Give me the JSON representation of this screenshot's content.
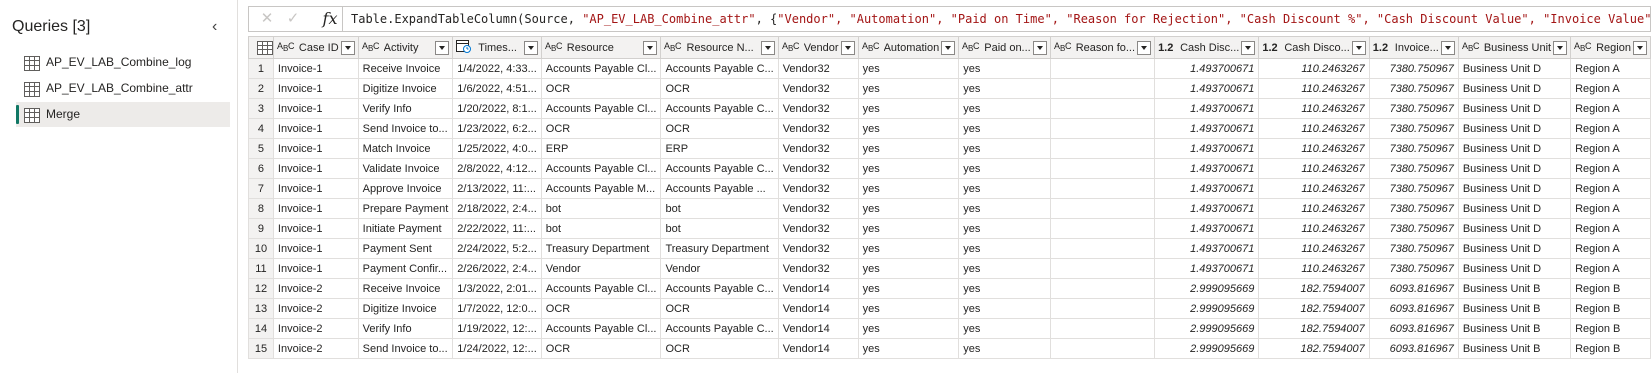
{
  "queries": {
    "header": "Queries [3]",
    "items": [
      {
        "label": "AP_EV_LAB_Combine_log",
        "selected": false
      },
      {
        "label": "AP_EV_LAB_Combine_attr",
        "selected": false
      },
      {
        "label": "Merge",
        "selected": true
      }
    ]
  },
  "formula": {
    "prefix": "Table.ExpandTableColumn(Source, ",
    "arg1": "\"AP_EV_LAB_Combine_attr\"",
    "mid": ", {",
    "cols": "\"Vendor\", \"Automation\", \"Paid on Time\", \"Reason for Rejection\", \"Cash Discount %\", \"Cash Discount Value\", \"Invoice Value\", \"Business Unit\""
  },
  "columns": [
    {
      "label": "Case ID",
      "type": "ABC"
    },
    {
      "label": "Activity",
      "type": "ABC"
    },
    {
      "label": "Times...",
      "type": "datetime"
    },
    {
      "label": "Resource",
      "type": "ABC"
    },
    {
      "label": "Resource N...",
      "type": "ABC"
    },
    {
      "label": "Vendor",
      "type": "ABC"
    },
    {
      "label": "Automation",
      "type": "ABC"
    },
    {
      "label": "Paid on...",
      "type": "ABC"
    },
    {
      "label": "Reason fo...",
      "type": "ABC"
    },
    {
      "label": "Cash Disc...",
      "type": "1.2"
    },
    {
      "label": "Cash Disco...",
      "type": "1.2"
    },
    {
      "label": "Invoice...",
      "type": "1.2"
    },
    {
      "label": "Business Unit",
      "type": "ABC"
    },
    {
      "label": "Region",
      "type": "ABC"
    }
  ],
  "rows": [
    [
      "1",
      "Invoice-1",
      "Receive Invoice",
      "1/4/2022, 4:33...",
      "Accounts Payable Cl...",
      "Accounts Payable C...",
      "Vendor32",
      "yes",
      "yes",
      "",
      "1.493700671",
      "110.2463267",
      "7380.750967",
      "Business Unit D",
      "Region A"
    ],
    [
      "2",
      "Invoice-1",
      "Digitize Invoice",
      "1/6/2022, 4:51...",
      "OCR",
      "OCR",
      "Vendor32",
      "yes",
      "yes",
      "",
      "1.493700671",
      "110.2463267",
      "7380.750967",
      "Business Unit D",
      "Region A"
    ],
    [
      "3",
      "Invoice-1",
      "Verify Info",
      "1/20/2022, 8:1...",
      "Accounts Payable Cl...",
      "Accounts Payable C...",
      "Vendor32",
      "yes",
      "yes",
      "",
      "1.493700671",
      "110.2463267",
      "7380.750967",
      "Business Unit D",
      "Region A"
    ],
    [
      "4",
      "Invoice-1",
      "Send Invoice to...",
      "1/23/2022, 6:2...",
      "OCR",
      "OCR",
      "Vendor32",
      "yes",
      "yes",
      "",
      "1.493700671",
      "110.2463267",
      "7380.750967",
      "Business Unit D",
      "Region A"
    ],
    [
      "5",
      "Invoice-1",
      "Match Invoice",
      "1/25/2022, 4:0...",
      "ERP",
      "ERP",
      "Vendor32",
      "yes",
      "yes",
      "",
      "1.493700671",
      "110.2463267",
      "7380.750967",
      "Business Unit D",
      "Region A"
    ],
    [
      "6",
      "Invoice-1",
      "Validate Invoice",
      "2/8/2022, 4:12...",
      "Accounts Payable Cl...",
      "Accounts Payable C...",
      "Vendor32",
      "yes",
      "yes",
      "",
      "1.493700671",
      "110.2463267",
      "7380.750967",
      "Business Unit D",
      "Region A"
    ],
    [
      "7",
      "Invoice-1",
      "Approve Invoice",
      "2/13/2022, 11:...",
      "Accounts Payable M...",
      "Accounts Payable ...",
      "Vendor32",
      "yes",
      "yes",
      "",
      "1.493700671",
      "110.2463267",
      "7380.750967",
      "Business Unit D",
      "Region A"
    ],
    [
      "8",
      "Invoice-1",
      "Prepare Payment",
      "2/18/2022, 2:4...",
      "bot",
      "bot",
      "Vendor32",
      "yes",
      "yes",
      "",
      "1.493700671",
      "110.2463267",
      "7380.750967",
      "Business Unit D",
      "Region A"
    ],
    [
      "9",
      "Invoice-1",
      "Initiate Payment",
      "2/22/2022, 11:...",
      "bot",
      "bot",
      "Vendor32",
      "yes",
      "yes",
      "",
      "1.493700671",
      "110.2463267",
      "7380.750967",
      "Business Unit D",
      "Region A"
    ],
    [
      "10",
      "Invoice-1",
      "Payment Sent",
      "2/24/2022, 5:2...",
      "Treasury Department",
      "Treasury Department",
      "Vendor32",
      "yes",
      "yes",
      "",
      "1.493700671",
      "110.2463267",
      "7380.750967",
      "Business Unit D",
      "Region A"
    ],
    [
      "11",
      "Invoice-1",
      "Payment Confir...",
      "2/26/2022, 2:4...",
      "Vendor",
      "Vendor",
      "Vendor32",
      "yes",
      "yes",
      "",
      "1.493700671",
      "110.2463267",
      "7380.750967",
      "Business Unit D",
      "Region A"
    ],
    [
      "12",
      "Invoice-2",
      "Receive Invoice",
      "1/3/2022, 2:01...",
      "Accounts Payable Cl...",
      "Accounts Payable C...",
      "Vendor14",
      "yes",
      "yes",
      "",
      "2.999095669",
      "182.7594007",
      "6093.816967",
      "Business Unit B",
      "Region B"
    ],
    [
      "13",
      "Invoice-2",
      "Digitize Invoice",
      "1/7/2022, 12:0...",
      "OCR",
      "OCR",
      "Vendor14",
      "yes",
      "yes",
      "",
      "2.999095669",
      "182.7594007",
      "6093.816967",
      "Business Unit B",
      "Region B"
    ],
    [
      "14",
      "Invoice-2",
      "Verify Info",
      "1/19/2022, 12:...",
      "Accounts Payable Cl...",
      "Accounts Payable C...",
      "Vendor14",
      "yes",
      "yes",
      "",
      "2.999095669",
      "182.7594007",
      "6093.816967",
      "Business Unit B",
      "Region B"
    ],
    [
      "15",
      "Invoice-2",
      "Send Invoice to...",
      "1/24/2022, 12:...",
      "OCR",
      "OCR",
      "Vendor14",
      "yes",
      "yes",
      "",
      "2.999095669",
      "182.7594007",
      "6093.816967",
      "Business Unit B",
      "Region B"
    ]
  ]
}
